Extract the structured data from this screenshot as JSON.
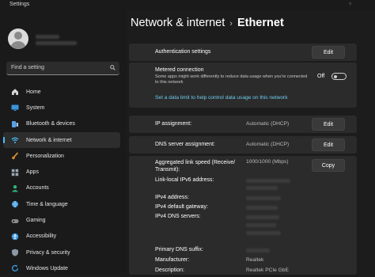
{
  "window": {
    "title": "Settings"
  },
  "search": {
    "placeholder": "Find a setting"
  },
  "sidebar": {
    "items": [
      {
        "label": "Home",
        "icon": "home-icon"
      },
      {
        "label": "System",
        "icon": "system-icon"
      },
      {
        "label": "Bluetooth & devices",
        "icon": "bluetooth-icon"
      },
      {
        "label": "Network & internet",
        "icon": "wifi-icon",
        "active": true
      },
      {
        "label": "Personalization",
        "icon": "brush-icon"
      },
      {
        "label": "Apps",
        "icon": "apps-icon"
      },
      {
        "label": "Accounts",
        "icon": "accounts-icon"
      },
      {
        "label": "Time & language",
        "icon": "globe-icon"
      },
      {
        "label": "Gaming",
        "icon": "gaming-icon"
      },
      {
        "label": "Accessibility",
        "icon": "accessibility-icon"
      },
      {
        "label": "Privacy & security",
        "icon": "shield-icon"
      },
      {
        "label": "Windows Update",
        "icon": "update-icon"
      }
    ]
  },
  "breadcrumb": {
    "parent": "Network & internet",
    "separator": "›",
    "current": "Ethernet"
  },
  "auth": {
    "label": "Authentication settings",
    "button": "Edit"
  },
  "metered": {
    "title": "Metered connection",
    "description": "Some apps might work differently to reduce data usage when you're connected to this network",
    "toggle_label": "Off",
    "toggle_on": false,
    "link": "Set a data limit to help control data usage on this network"
  },
  "ip": {
    "label": "IP assignment:",
    "value": "Automatic (DHCP)",
    "button": "Edit"
  },
  "dns": {
    "label": "DNS server assignment:",
    "value": "Automatic (DHCP)",
    "button": "Edit"
  },
  "properties": {
    "copy_button": "Copy",
    "link_speed_label": "Aggregated link speed (Receive/ Transmit):",
    "link_speed_value": "1000/1000 (Mbps)",
    "ipv6_label": "Link-local IPv6 address:",
    "ipv4_label": "IPv4 address:",
    "gateway_label": "IPv4 default gateway:",
    "dns_servers_label": "IPv4 DNS servers:",
    "dns_suffix_label": "Primary DNS suffix:",
    "manufacturer_label": "Manufacturer:",
    "manufacturer_value": "Realtek",
    "description_label": "Description:",
    "description_value": "Realtek PCIe GbE"
  },
  "colors": {
    "accent": "#4cc2ff",
    "link": "#6fcdf2",
    "card": "#2b2b2b",
    "background": "#1c1c1c"
  }
}
